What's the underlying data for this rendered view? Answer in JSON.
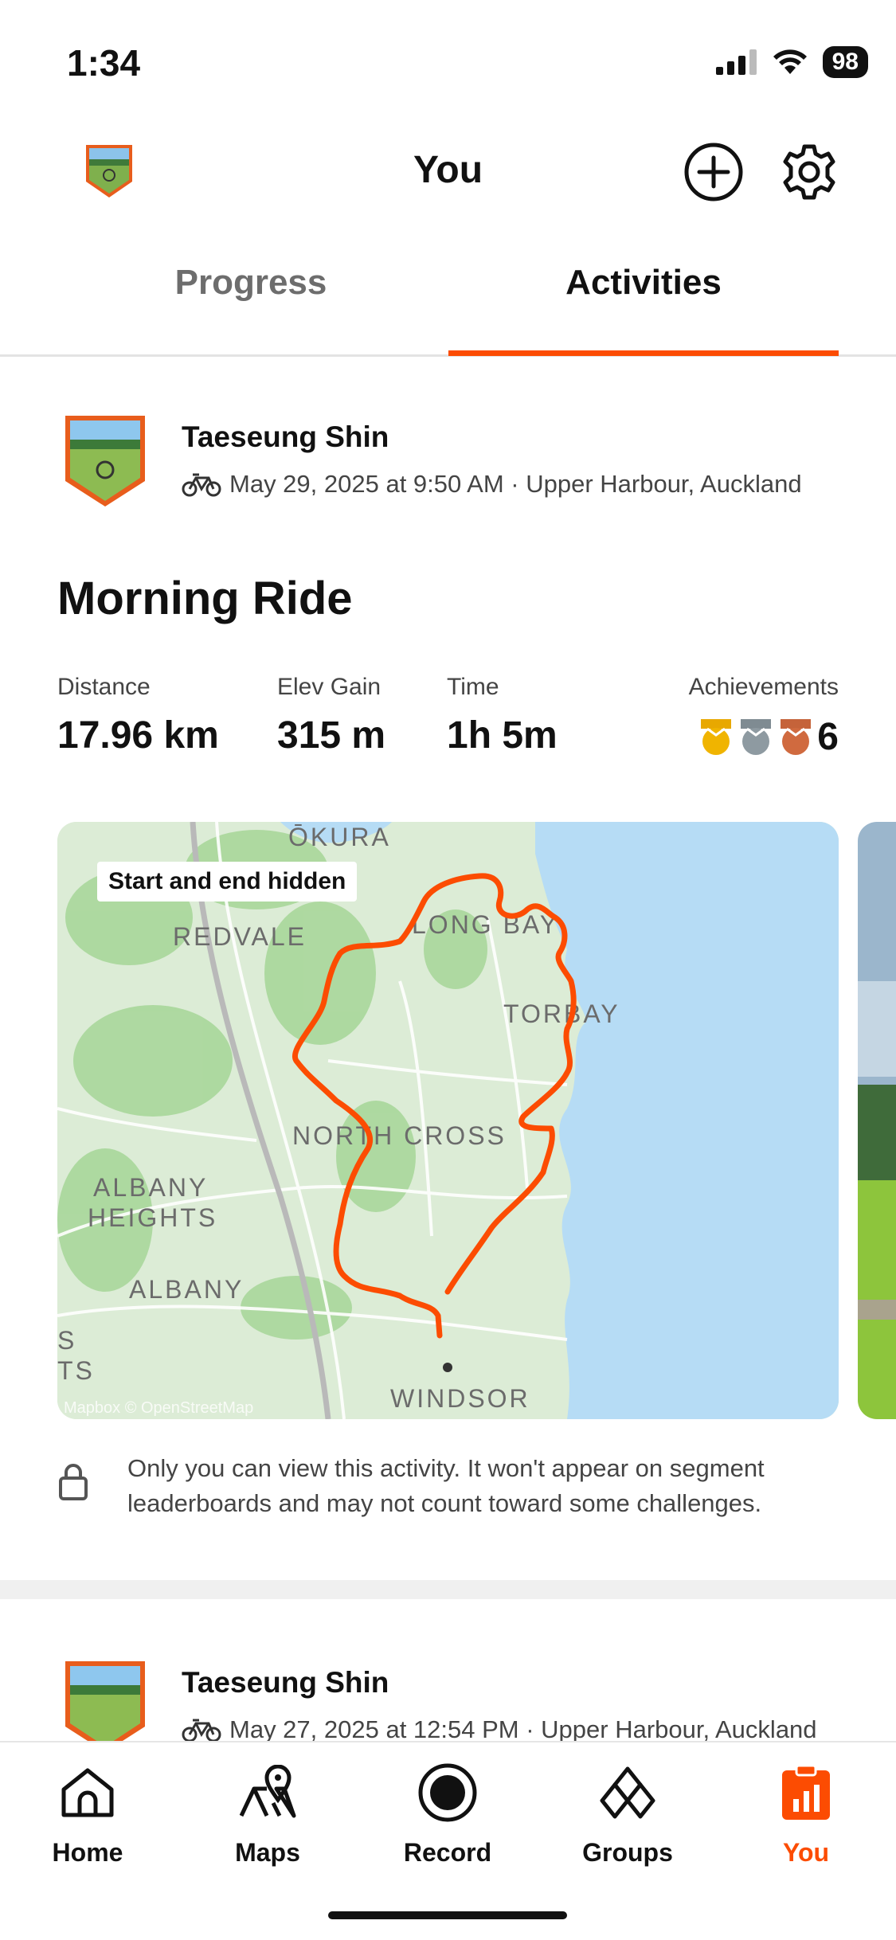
{
  "status_bar": {
    "time": "1:34",
    "battery": "98"
  },
  "header": {
    "title": "You"
  },
  "tabs": [
    {
      "label": "Progress",
      "active": false
    },
    {
      "label": "Activities",
      "active": true
    }
  ],
  "activities": [
    {
      "athlete": "Taeseung Shin",
      "meta": "May 29, 2025 at 9:50 AM · Upper Harbour, Auckland",
      "title": "Morning Ride",
      "stats": {
        "distance": {
          "label": "Distance",
          "value": "17.96 km"
        },
        "elev_gain": {
          "label": "Elev Gain",
          "value": "315 m"
        },
        "time": {
          "label": "Time",
          "value": "1h 5m"
        },
        "achievements": {
          "label": "Achievements",
          "value": "6"
        }
      },
      "map": {
        "badge": "Start and end hidden",
        "attribution": "Mapbox © OpenStreetMap",
        "places": [
          "ŌKURA",
          "REDVALE",
          "LONG BAY",
          "TORBAY",
          "NORTH CROSS",
          "ALBANY",
          "HEIGHTS",
          "ALBANY",
          "WINDSOR",
          "S",
          "TS"
        ],
        "route_color": "#fc4c02"
      },
      "privacy_note": "Only you can view this activity. It won't appear on segment leaderboards and may not count toward some challenges."
    },
    {
      "athlete": "Taeseung Shin",
      "meta": "May 27, 2025 at 12:54 PM · Upper Harbour, Auckland"
    }
  ],
  "bottom_nav": [
    {
      "label": "Home",
      "icon": "home-icon",
      "active": false
    },
    {
      "label": "Maps",
      "icon": "maps-icon",
      "active": false
    },
    {
      "label": "Record",
      "icon": "record-icon",
      "active": false
    },
    {
      "label": "Groups",
      "icon": "groups-icon",
      "active": false
    },
    {
      "label": "You",
      "icon": "you-icon",
      "active": true
    }
  ],
  "colors": {
    "accent": "#fc4c02",
    "water": "#b6dcf5",
    "land": "#dcecd6"
  }
}
